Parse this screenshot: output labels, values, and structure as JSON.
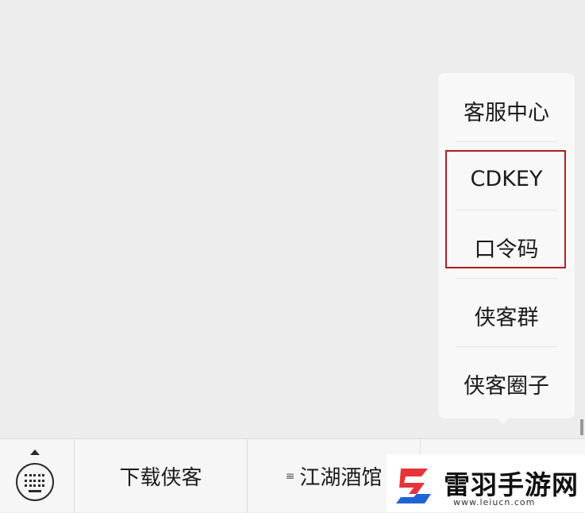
{
  "menu": {
    "items": [
      {
        "label": "客服中心"
      },
      {
        "label": "CDKEY"
      },
      {
        "label": "口令码"
      },
      {
        "label": "侠客群"
      },
      {
        "label": "侠客圈子"
      }
    ]
  },
  "highlight_color": "#b11d25",
  "bottom_bar": {
    "keyboard_icon": "keyboard-icon",
    "tabs": [
      {
        "label": "下载侠客"
      },
      {
        "label": "江湖酒馆",
        "icon": "menu-lines-icon"
      }
    ]
  },
  "watermark": {
    "title": "雷羽手游网",
    "url": "www.leiucn.com",
    "logo_colors": [
      "#e8323a",
      "#1f63d6"
    ]
  }
}
